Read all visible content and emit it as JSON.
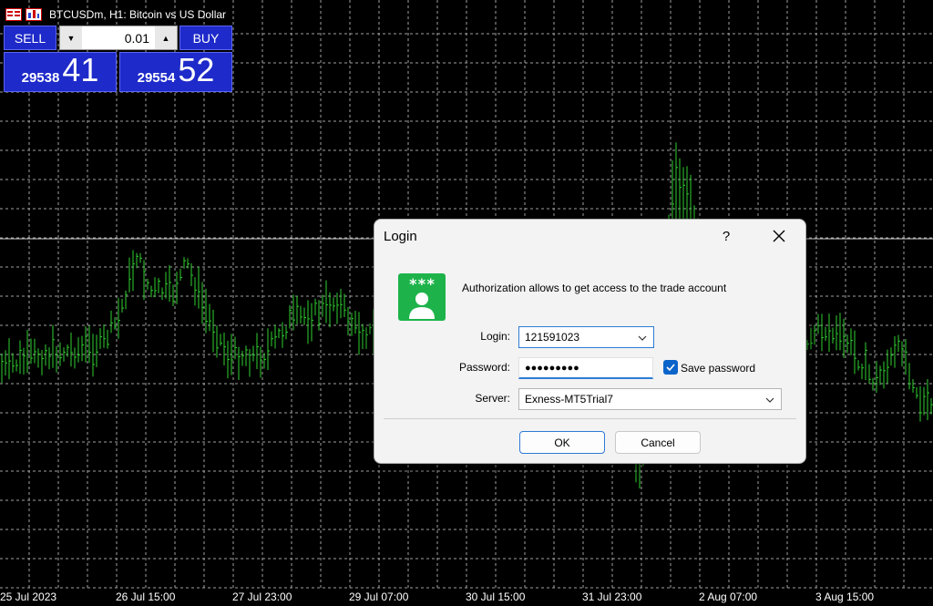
{
  "chart": {
    "title": "BTCUSDm, H1:  Bitcoin vs US Dollar",
    "grid_color": "#a0a0a0",
    "bar_color": "#2fcf2f",
    "time_labels": [
      "25 Jul 2023",
      "26 Jul 15:00",
      "27 Jul 23:00",
      "29 Jul 07:00",
      "30 Jul 15:00",
      "31 Jul 23:00",
      "2 Aug 07:00",
      "3 Aug 15:00"
    ]
  },
  "trade_panel": {
    "sell_label": "SELL",
    "buy_label": "BUY",
    "lot": "0.01",
    "sell_price_small": "29538",
    "sell_price_big": "41",
    "buy_price_small": "29554",
    "buy_price_big": "52",
    "panel_color": "#1e2ac9"
  },
  "dialog": {
    "title": "Login",
    "help": "?",
    "auth_text": "Authorization allows to get access to the trade account",
    "login_label": "Login:",
    "login_value": "121591023",
    "password_label": "Password:",
    "password_value": "●●●●●●●●●",
    "save_password_label": "Save password",
    "save_password_checked": true,
    "server_label": "Server:",
    "server_value": "Exness-MT5Trial7",
    "ok_label": "OK",
    "cancel_label": "Cancel",
    "icon_text": "***"
  }
}
